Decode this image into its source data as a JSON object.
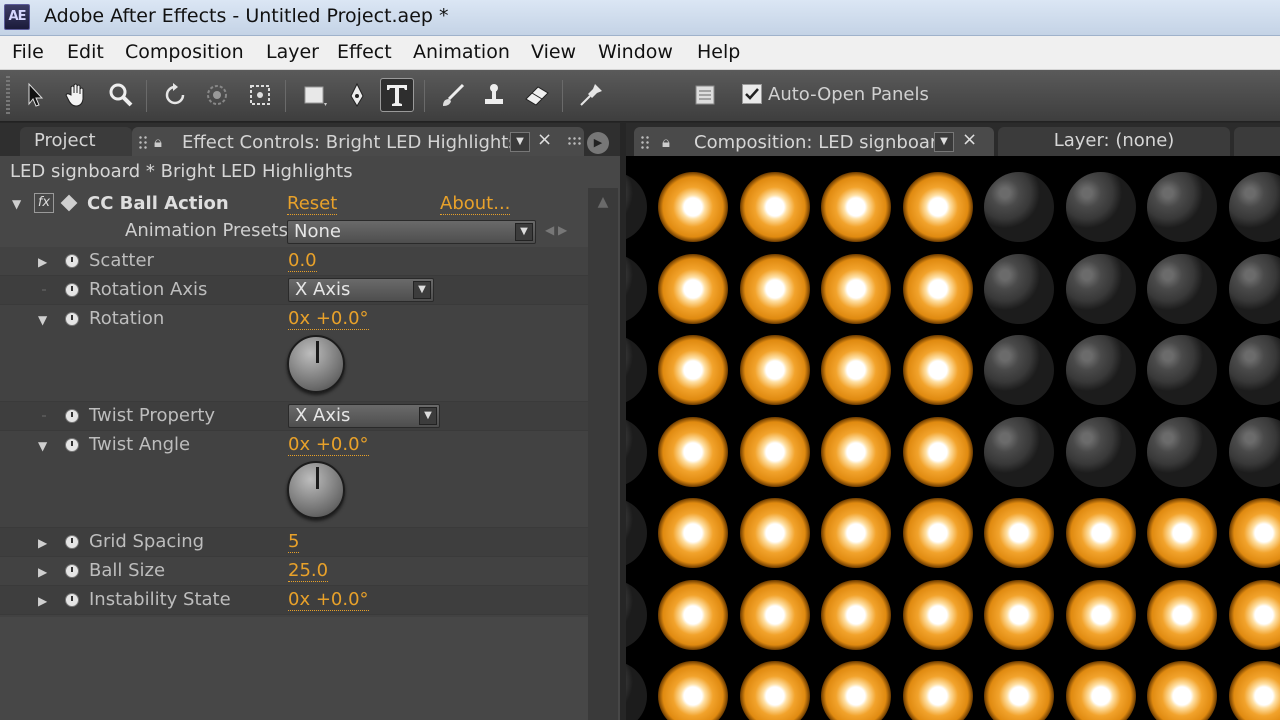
{
  "app": {
    "logo_text": "AE",
    "title": "Adobe After Effects - Untitled Project.aep *"
  },
  "menu": [
    "File",
    "Edit",
    "Composition",
    "Layer",
    "Effect",
    "Animation",
    "View",
    "Window",
    "Help"
  ],
  "toolbar": {
    "tools": [
      "selection-tool",
      "hand-tool",
      "zoom-tool",
      "rotation-tool",
      "orbit-camera-tool",
      "pan-behind-tool",
      "rectangle-tool",
      "pen-tool",
      "type-tool",
      "brush-tool",
      "clone-stamp-tool",
      "eraser-tool",
      "puppet-pin-tool"
    ],
    "active_tool": "type-tool",
    "auto_open_checked": true,
    "auto_open_label": "Auto-Open Panels"
  },
  "left_panel": {
    "tab_project": "Project",
    "tab_effect": "Effect Controls: Bright LED Highlights",
    "breadcrumb": "LED signboard * Bright LED Highlights",
    "effect": {
      "name": "CC Ball Action",
      "reset": "Reset",
      "about": "About...",
      "presets_label": "Animation Presets:",
      "presets_value": "None"
    },
    "properties": [
      {
        "label": "Scatter",
        "value": "0.0"
      },
      {
        "label": "Rotation Axis",
        "value": "X Axis"
      },
      {
        "label": "Rotation",
        "value": "0x +0.0°"
      },
      {
        "label": "Twist Property",
        "value": "X Axis"
      },
      {
        "label": "Twist Angle",
        "value": "0x +0.0°"
      },
      {
        "label": "Grid Spacing",
        "value": "5"
      },
      {
        "label": "Ball Size",
        "value": "25.0"
      },
      {
        "label": "Instability State",
        "value": "0x +0.0°"
      }
    ]
  },
  "comp_panel": {
    "tab_comp": "Composition: LED signboard",
    "tab_layer": "Layer: (none)",
    "led_grid": [
      [
        1,
        1,
        1,
        1,
        0,
        0,
        0,
        0
      ],
      [
        1,
        1,
        1,
        1,
        0,
        0,
        0,
        0
      ],
      [
        1,
        1,
        1,
        1,
        0,
        0,
        0,
        0
      ],
      [
        1,
        1,
        1,
        1,
        0,
        0,
        0,
        0
      ],
      [
        1,
        1,
        1,
        1,
        1,
        1,
        1,
        1
      ],
      [
        1,
        1,
        1,
        1,
        1,
        1,
        1,
        1
      ],
      [
        1,
        1,
        1,
        1,
        1,
        1,
        1,
        1
      ]
    ],
    "colors": {
      "led_on": "#f2a32c",
      "led_off": "#4a4a4a",
      "accent_value": "#e8a12a"
    }
  }
}
